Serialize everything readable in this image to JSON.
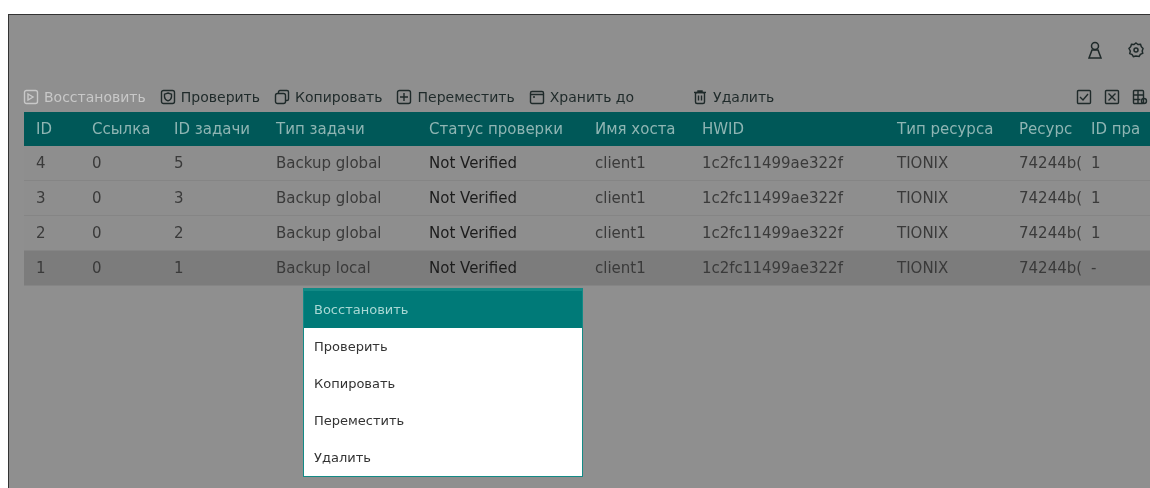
{
  "toolbar": {
    "actions": [
      {
        "label": "Восстановить",
        "kind": "restore",
        "disabled": true
      },
      {
        "label": "Проверить",
        "kind": "verify",
        "disabled": false
      },
      {
        "label": "Копировать",
        "kind": "copy",
        "disabled": false
      },
      {
        "label": "Переместить",
        "kind": "move",
        "disabled": false
      },
      {
        "label": "Хранить до",
        "kind": "calendar",
        "disabled": false
      },
      {
        "label": "Удалить",
        "kind": "delete",
        "disabled": false
      }
    ]
  },
  "table": {
    "columns": [
      "ID",
      "Ссылка",
      "ID задачи",
      "Тип задачи",
      "Статус проверки",
      "Имя хоста",
      "HWID",
      "Тип ресурса",
      "Ресурс",
      "ID пра"
    ],
    "rows": [
      {
        "selected": false,
        "cells": [
          "4",
          "0",
          "5",
          "Backup global",
          "Not Verified",
          "client1",
          "1c2fc11499ae322f",
          "TIONIX",
          "74244b(",
          "1"
        ]
      },
      {
        "selected": false,
        "cells": [
          "3",
          "0",
          "3",
          "Backup global",
          "Not Verified",
          "client1",
          "1c2fc11499ae322f",
          "TIONIX",
          "74244b(",
          "1"
        ]
      },
      {
        "selected": false,
        "cells": [
          "2",
          "0",
          "2",
          "Backup global",
          "Not Verified",
          "client1",
          "1c2fc11499ae322f",
          "TIONIX",
          "74244b(",
          "1"
        ]
      },
      {
        "selected": true,
        "cells": [
          "1",
          "0",
          "1",
          "Backup local",
          "Not Verified",
          "client1",
          "1c2fc11499ae322f",
          "TIONIX",
          "74244b(",
          "-"
        ]
      }
    ]
  },
  "context_menu": {
    "items": [
      {
        "label": "Восстановить",
        "selected": true
      },
      {
        "label": "Проверить",
        "selected": false
      },
      {
        "label": "Копировать",
        "selected": false
      },
      {
        "label": "Переместить",
        "selected": false
      },
      {
        "label": "Удалить",
        "selected": false
      }
    ]
  }
}
